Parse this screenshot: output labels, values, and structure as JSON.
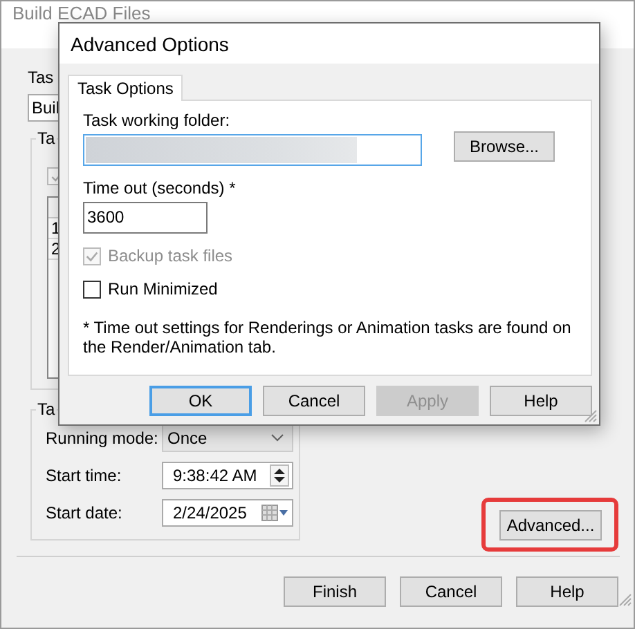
{
  "background_window": {
    "title": "Build ECAD Files",
    "task_label": "Tas",
    "task_combo": "Buil",
    "task_group": {
      "label": "Ta",
      "checkbox": {
        "checked": true,
        "disabled": true
      },
      "table_rows": [
        "1",
        "2"
      ]
    },
    "schedule_group": {
      "label": "Ta",
      "fields": [
        {
          "label": "Running mode:",
          "value": "Once",
          "kind": "dropdown"
        },
        {
          "label": "Start time:",
          "value": "9:38:42 AM",
          "kind": "spinner"
        },
        {
          "label": "Start date:",
          "value": "2/24/2025",
          "kind": "date"
        }
      ]
    },
    "advanced_button": {
      "label": "Advanced...",
      "highlighted": true
    },
    "buttons": [
      "Finish",
      "Cancel",
      "Help"
    ]
  },
  "dialog": {
    "title": "Advanced Options",
    "tabs": [
      {
        "label": "Task Options",
        "selected": true
      }
    ],
    "folder": {
      "label": "Task working folder:",
      "redacted": true
    },
    "browse_button": "Browse...",
    "timeout": {
      "label": "Time out (seconds) *",
      "value": "3600"
    },
    "checkboxes": [
      {
        "label": "Backup task files",
        "checked": true,
        "disabled": true
      },
      {
        "label": "Run Minimized",
        "checked": false,
        "disabled": false
      }
    ],
    "note": "* Time out settings for Renderings or Animation tasks are found on the Render/Animation tab.",
    "buttons": [
      {
        "label": "OK",
        "focused": true,
        "disabled": false
      },
      {
        "label": "Cancel",
        "focused": false,
        "disabled": false
      },
      {
        "label": "Apply",
        "focused": false,
        "disabled": true
      },
      {
        "label": "Help",
        "focused": false,
        "disabled": false
      }
    ]
  }
}
